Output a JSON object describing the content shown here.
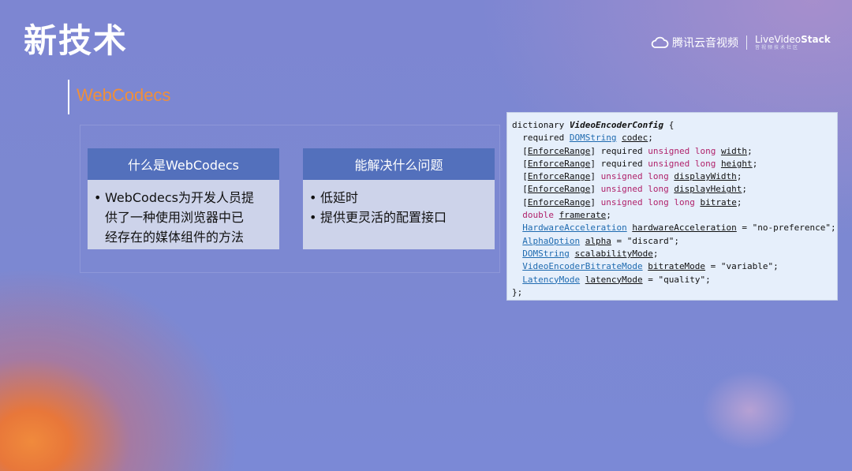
{
  "slide": {
    "title": "新技术",
    "section_title": "WebCodecs"
  },
  "brand": {
    "name": "腾讯云音视频",
    "partner_prefix": "Live",
    "partner_middle": "Video",
    "partner_suffix": "Stack",
    "partner_sub": "音视频技术社区",
    "icon": "cloud-icon"
  },
  "cards": [
    {
      "header": "什么是WebCodecs",
      "bullets": [
        "WebCodecs为开发人员提",
        "供了一种使用浏览器中已",
        "经存在的媒体组件的方法"
      ],
      "bullet_count": 1
    },
    {
      "header": "能解决什么问题",
      "bullets": [
        "低延时",
        "提供更灵活的配置接口"
      ],
      "bullet_count": 2
    }
  ],
  "code": {
    "lines": [
      [
        [
          "p",
          "dictionary "
        ],
        [
          "n",
          "VideoEncoderConfig"
        ],
        [
          "p",
          " {"
        ]
      ],
      [
        [
          "p",
          "  required "
        ],
        [
          "t",
          "DOMString"
        ],
        [
          "p",
          " "
        ],
        [
          "i",
          "codec"
        ],
        [
          "p",
          ";"
        ]
      ],
      [
        [
          "p",
          "  ["
        ],
        [
          "i",
          "EnforceRange"
        ],
        [
          "p",
          "] required "
        ],
        [
          "k",
          "unsigned long"
        ],
        [
          "p",
          " "
        ],
        [
          "i",
          "width"
        ],
        [
          "p",
          ";"
        ]
      ],
      [
        [
          "p",
          "  ["
        ],
        [
          "i",
          "EnforceRange"
        ],
        [
          "p",
          "] required "
        ],
        [
          "k",
          "unsigned long"
        ],
        [
          "p",
          " "
        ],
        [
          "i",
          "height"
        ],
        [
          "p",
          ";"
        ]
      ],
      [
        [
          "p",
          "  ["
        ],
        [
          "i",
          "EnforceRange"
        ],
        [
          "p",
          "] "
        ],
        [
          "k",
          "unsigned long"
        ],
        [
          "p",
          " "
        ],
        [
          "i",
          "displayWidth"
        ],
        [
          "p",
          ";"
        ]
      ],
      [
        [
          "p",
          "  ["
        ],
        [
          "i",
          "EnforceRange"
        ],
        [
          "p",
          "] "
        ],
        [
          "k",
          "unsigned long"
        ],
        [
          "p",
          " "
        ],
        [
          "i",
          "displayHeight"
        ],
        [
          "p",
          ";"
        ]
      ],
      [
        [
          "p",
          "  ["
        ],
        [
          "i",
          "EnforceRange"
        ],
        [
          "p",
          "] "
        ],
        [
          "k",
          "unsigned long long"
        ],
        [
          "p",
          " "
        ],
        [
          "i",
          "bitrate"
        ],
        [
          "p",
          ";"
        ]
      ],
      [
        [
          "p",
          "  "
        ],
        [
          "k",
          "double"
        ],
        [
          "p",
          " "
        ],
        [
          "i",
          "framerate"
        ],
        [
          "p",
          ";"
        ]
      ],
      [
        [
          "p",
          "  "
        ],
        [
          "t",
          "HardwareAcceleration"
        ],
        [
          "p",
          " "
        ],
        [
          "i",
          "hardwareAcceleration"
        ],
        [
          "p",
          " = \"no-preference\";"
        ]
      ],
      [
        [
          "p",
          "  "
        ],
        [
          "t",
          "AlphaOption"
        ],
        [
          "p",
          " "
        ],
        [
          "i",
          "alpha"
        ],
        [
          "p",
          " = \"discard\";"
        ]
      ],
      [
        [
          "p",
          "  "
        ],
        [
          "t",
          "DOMString"
        ],
        [
          "p",
          " "
        ],
        [
          "i",
          "scalabilityMode"
        ],
        [
          "p",
          ";"
        ]
      ],
      [
        [
          "p",
          "  "
        ],
        [
          "t",
          "VideoEncoderBitrateMode"
        ],
        [
          "p",
          " "
        ],
        [
          "i",
          "bitrateMode"
        ],
        [
          "p",
          " = \"variable\";"
        ]
      ],
      [
        [
          "p",
          "  "
        ],
        [
          "t",
          "LatencyMode"
        ],
        [
          "p",
          " "
        ],
        [
          "i",
          "latencyMode"
        ],
        [
          "p",
          " = \"quality\";"
        ]
      ],
      [
        [
          "p",
          "};"
        ]
      ]
    ]
  }
}
